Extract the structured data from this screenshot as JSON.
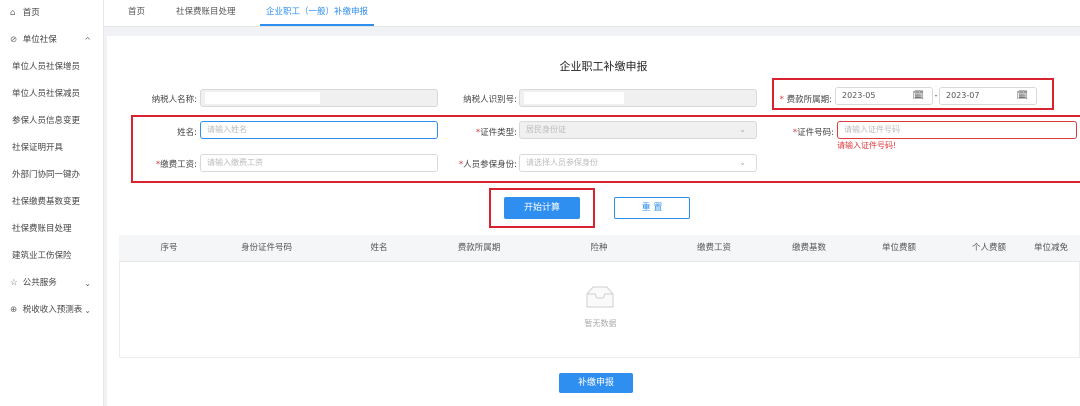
{
  "sidebar": {
    "items": [
      {
        "label": "首页",
        "icon": "⌂",
        "icon_name": "home-icon"
      },
      {
        "label": "单位社保",
        "icon": "⊘",
        "icon_name": "shield-icon",
        "chevron": "^"
      },
      {
        "label": "单位人员社保增员"
      },
      {
        "label": "单位人员社保减员"
      },
      {
        "label": "参保人员信息变更"
      },
      {
        "label": "社保证明开具"
      },
      {
        "label": "外部门协同一键办"
      },
      {
        "label": "社保缴费基数变更"
      },
      {
        "label": "社保费账目处理"
      },
      {
        "label": "建筑业工伤保险"
      },
      {
        "label": "公共服务",
        "icon": "☆",
        "icon_name": "star-icon",
        "chevron": "⌄"
      },
      {
        "label": "税收收入预测表",
        "icon": "⊕",
        "icon_name": "chart-icon",
        "chevron": "⌄"
      }
    ]
  },
  "tabs": [
    {
      "label": "首页"
    },
    {
      "label": "社保费账目处理"
    },
    {
      "label": "企业职工（一般）补缴申报"
    }
  ],
  "form": {
    "title": "企业职工补缴申报",
    "taxpayer_name_label": "纳税人名称:",
    "taxpayer_id_label": "纳税人识别号:",
    "period_label": "费款所属期:",
    "period_start": "2023-05",
    "period_end": "2023-07",
    "period_sep": "-",
    "name_label": "姓名:",
    "name_placeholder": "请输入姓名",
    "id_type_label": "证件类型:",
    "id_type_value": "居民身份证",
    "id_no_label": "证件号码:",
    "id_no_placeholder": "请输入证件号码",
    "id_no_error": "请输入证件号码!",
    "wage_label": "缴费工资:",
    "wage_placeholder": "请输入缴费工资",
    "identity_label": "人员参保身份:",
    "identity_placeholder": "请选择人员参保身份",
    "required_mark": "*",
    "calendar_glyph": "🗓",
    "select_arrow": "⌄"
  },
  "actions": {
    "calculate": "开始计算",
    "reset": "重 置",
    "submit": "补缴申报"
  },
  "table": {
    "columns": [
      "序号",
      "身份证件号码",
      "姓名",
      "费款所属期",
      "险种",
      "缴费工资",
      "缴费基数",
      "单位费额",
      "个人费额",
      "单位减免"
    ],
    "rows": [],
    "empty_text": "暂无数据"
  }
}
